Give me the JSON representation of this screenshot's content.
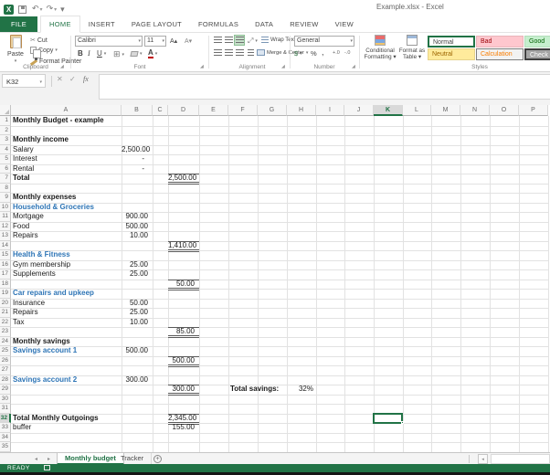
{
  "window": {
    "title": "Example.xlsx - Excel"
  },
  "icons": {
    "logo": "X",
    "undo": "↶",
    "redo": "↷",
    "qat_more": "▾",
    "dropdown": "▾",
    "cut": "✂",
    "bold": "B",
    "italic": "I",
    "underline": "U",
    "borders": "⊞",
    "fontcolor": "A",
    "orientation": "⤢",
    "grow_font": "A▴",
    "shrink_font": "A▾",
    "currency": "$",
    "percent": "%",
    "comma": ",",
    "inc_decimal": "+.0",
    "dec_decimal": "-.0",
    "cancel": "✕",
    "enter": "✓",
    "fx": "fx",
    "nav_left": "◂",
    "nav_right": "▸",
    "scroll_left": "◂",
    "plus": "+",
    "launcher": "◢"
  },
  "ribbon": {
    "tabs": [
      {
        "label": "FILE"
      },
      {
        "label": "HOME"
      },
      {
        "label": "INSERT"
      },
      {
        "label": "PAGE LAYOUT"
      },
      {
        "label": "FORMULAS"
      },
      {
        "label": "DATA"
      },
      {
        "label": "REVIEW"
      },
      {
        "label": "VIEW"
      }
    ],
    "clipboard": {
      "paste": "Paste",
      "cut": "Cut",
      "copy": "Copy",
      "format_painter": "Format Painter",
      "group": "Clipboard"
    },
    "font": {
      "name": "Calibri",
      "size": "11",
      "group": "Font"
    },
    "alignment": {
      "wrap": "Wrap Text",
      "merge": "Merge & Center",
      "group": "Alignment"
    },
    "number": {
      "format": "General",
      "group": "Number"
    },
    "styles": {
      "conditional_line1": "Conditional",
      "conditional_line2": "Formatting ▾",
      "format_table_line1": "Format as",
      "format_table_line2": "Table ▾",
      "group": "Styles",
      "items": [
        {
          "label": "Normal",
          "bg": "#ffffff",
          "fg": "#444444",
          "border": "2px solid #217346"
        },
        {
          "label": "Bad",
          "bg": "#ffc7ce",
          "fg": "#9c0006",
          "border": "1px solid #e8b4ba"
        },
        {
          "label": "Good",
          "bg": "#c6efce",
          "fg": "#006100",
          "border": "1px solid #b2dcba"
        },
        {
          "label": "Neutral",
          "bg": "#ffeb9c",
          "fg": "#9c6500",
          "border": "1px solid #e6d28a"
        },
        {
          "label": "Calculation",
          "bg": "#f2f2f2",
          "fg": "#fa7d00",
          "border": "1px solid #7f7f7f"
        },
        {
          "label": "Check Cell",
          "bg": "#a5a5a5",
          "fg": "#ffffff",
          "border": "2px solid #3f3f3f"
        }
      ]
    }
  },
  "formula_bar": {
    "name_box": "K32"
  },
  "grid": {
    "columns": [
      "A",
      "B",
      "C",
      "D",
      "E",
      "F",
      "G",
      "H",
      "I",
      "J",
      "K",
      "L",
      "M",
      "N",
      "O",
      "P"
    ],
    "row_count": 35,
    "selected_column": "K",
    "selected_row": 32,
    "selection_ref": "K32",
    "accent_green": "#217346",
    "heading_blue": "#2e75b6",
    "cells": [
      {
        "row": 1,
        "col": "A",
        "text": "Monthly Budget - example",
        "style": "bold"
      },
      {
        "row": 3,
        "col": "A",
        "text": "Monthly income",
        "style": "bold"
      },
      {
        "row": 4,
        "col": "A",
        "text": "Salary",
        "style": ""
      },
      {
        "row": 4,
        "col": "B",
        "text": "2,500.00",
        "style": "num"
      },
      {
        "row": 5,
        "col": "A",
        "text": "Interest",
        "style": ""
      },
      {
        "row": 5,
        "col": "B",
        "text": "-",
        "style": "num dash"
      },
      {
        "row": 6,
        "col": "A",
        "text": "Rental",
        "style": ""
      },
      {
        "row": 6,
        "col": "B",
        "text": "-",
        "style": "num dash"
      },
      {
        "row": 7,
        "col": "A",
        "text": "Total",
        "style": "bold"
      },
      {
        "row": 7,
        "col": "D",
        "text": "2,500.00",
        "style": "num total"
      },
      {
        "row": 9,
        "col": "A",
        "text": "Monthly expenses",
        "style": "bold"
      },
      {
        "row": 10,
        "col": "A",
        "text": "Household & Groceries",
        "style": "blue"
      },
      {
        "row": 11,
        "col": "A",
        "text": "Mortgage",
        "style": ""
      },
      {
        "row": 11,
        "col": "B",
        "text": "900.00",
        "style": "num"
      },
      {
        "row": 12,
        "col": "A",
        "text": "Food",
        "style": ""
      },
      {
        "row": 12,
        "col": "B",
        "text": "500.00",
        "style": "num"
      },
      {
        "row": 13,
        "col": "A",
        "text": "Repairs",
        "style": ""
      },
      {
        "row": 13,
        "col": "B",
        "text": "10.00",
        "style": "num"
      },
      {
        "row": 14,
        "col": "D",
        "text": "1,410.00",
        "style": "num total"
      },
      {
        "row": 15,
        "col": "A",
        "text": "Health & Fitness",
        "style": "blue"
      },
      {
        "row": 16,
        "col": "A",
        "text": "Gym membership",
        "style": ""
      },
      {
        "row": 16,
        "col": "B",
        "text": "25.00",
        "style": "num"
      },
      {
        "row": 17,
        "col": "A",
        "text": "Supplements",
        "style": ""
      },
      {
        "row": 17,
        "col": "B",
        "text": "25.00",
        "style": "num"
      },
      {
        "row": 18,
        "col": "D",
        "text": "50.00",
        "style": "num total"
      },
      {
        "row": 19,
        "col": "A",
        "text": "Car repairs and upkeep",
        "style": "blue"
      },
      {
        "row": 20,
        "col": "A",
        "text": "Insurance",
        "style": ""
      },
      {
        "row": 20,
        "col": "B",
        "text": "50.00",
        "style": "num"
      },
      {
        "row": 21,
        "col": "A",
        "text": "Repairs",
        "style": ""
      },
      {
        "row": 21,
        "col": "B",
        "text": "25.00",
        "style": "num"
      },
      {
        "row": 22,
        "col": "A",
        "text": "Tax",
        "style": ""
      },
      {
        "row": 22,
        "col": "B",
        "text": "10.00",
        "style": "num"
      },
      {
        "row": 23,
        "col": "D",
        "text": "85.00",
        "style": "num total"
      },
      {
        "row": 24,
        "col": "A",
        "text": "Monthly savings",
        "style": "bold"
      },
      {
        "row": 25,
        "col": "A",
        "text": "Savings account 1",
        "style": "blue"
      },
      {
        "row": 25,
        "col": "B",
        "text": "500.00",
        "style": "num"
      },
      {
        "row": 26,
        "col": "D",
        "text": "500.00",
        "style": "num total"
      },
      {
        "row": 28,
        "col": "A",
        "text": "Savings account 2",
        "style": "blue"
      },
      {
        "row": 28,
        "col": "B",
        "text": "300.00",
        "style": "num"
      },
      {
        "row": 29,
        "col": "D",
        "text": "300.00",
        "style": "num total"
      },
      {
        "row": 29,
        "col": "F",
        "text": "Total savings:",
        "style": "bold"
      },
      {
        "row": 29,
        "col": "H",
        "text": "32%",
        "style": "num pct"
      },
      {
        "row": 32,
        "col": "A",
        "text": "Total Monthly Outgoings",
        "style": "bold"
      },
      {
        "row": 32,
        "col": "D",
        "text": "2,345.00",
        "style": "num total"
      },
      {
        "row": 33,
        "col": "A",
        "text": "buffer",
        "style": ""
      },
      {
        "row": 33,
        "col": "D",
        "text": "155.00",
        "style": "num"
      }
    ]
  },
  "sheet_tabs": [
    {
      "label": "Monthly budget",
      "active": true
    },
    {
      "label": "Tracker",
      "active": false
    }
  ],
  "status_bar": {
    "mode": "READY"
  }
}
